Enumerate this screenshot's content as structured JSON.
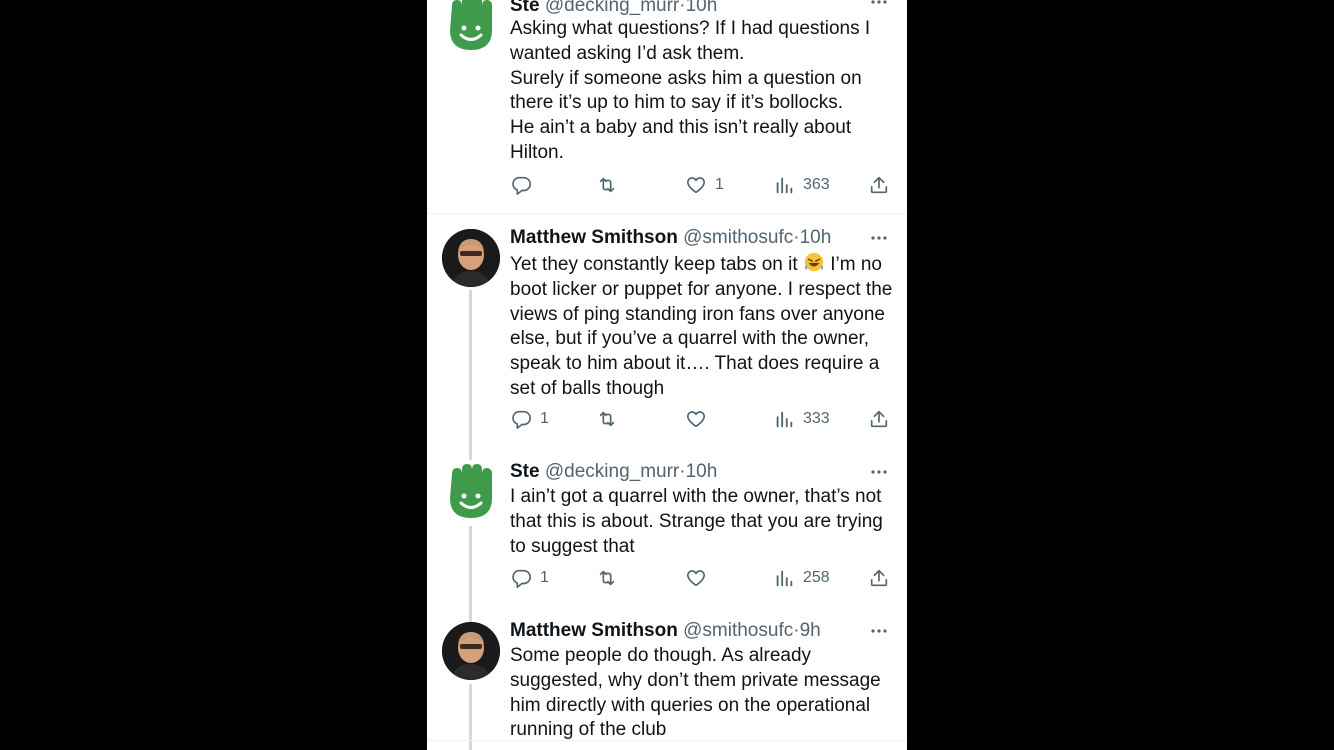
{
  "tweets": [
    {
      "name": "Ste",
      "handle": "@decking_murr",
      "dot": "·",
      "time": "10h",
      "text": "Asking what questions? If I had questions I wanted asking I’d ask them.\nSurely if someone asks him a question on there it’s up to him to say if it’s bollocks.\nHe ain’t a baby and this isn’t really about Hilton.",
      "replies": "",
      "retweets": "",
      "likes": "1",
      "views": "363"
    },
    {
      "name": "Matthew Smithson",
      "handle": "@smithosufc",
      "dot": "·",
      "time": "10h",
      "text_before_emoji": "Yet they constantly keep tabs on it",
      "emoji": "rolling-on-floor-laughing",
      "text_after_emoji": " I’m no boot licker or puppet for anyone. I respect the views of ping standing iron fans over anyone else, but if you’ve a quarrel with the owner, speak to him about it…. That does require a set of balls though",
      "replies": "1",
      "retweets": "",
      "likes": "",
      "views": "333"
    },
    {
      "name": "Ste",
      "handle": "@decking_murr",
      "dot": "·",
      "time": "10h",
      "text": "I ain’t got a quarrel with the owner, that’s not that this is about. Strange that you are trying to suggest that",
      "replies": "1",
      "retweets": "",
      "likes": "",
      "views": "258"
    },
    {
      "name": "Matthew Smithson",
      "handle": "@smithosufc",
      "dot": "·",
      "time": "9h",
      "text": "Some people do though. As already suggested, why don’t them private message him directly with queries on the operational running of the club"
    }
  ],
  "colors": {
    "text": "#0f1419",
    "muted": "#536471",
    "hand_avatar": "#3f9b4b",
    "thread_line": "#cfd9de"
  },
  "icons": [
    "reply-icon",
    "retweet-icon",
    "like-icon",
    "views-icon",
    "share-icon",
    "more-icon"
  ]
}
